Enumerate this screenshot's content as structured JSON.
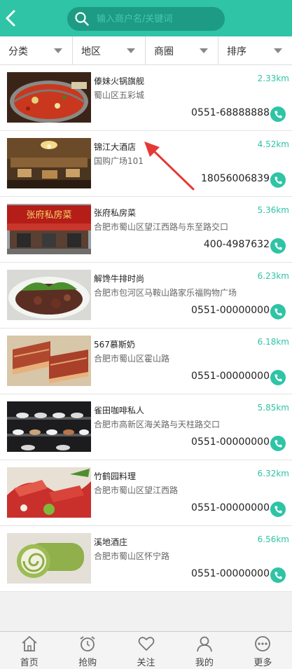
{
  "header": {
    "search_placeholder": "输入商户名/关键词"
  },
  "filters": [
    {
      "label": "分类"
    },
    {
      "label": "地区"
    },
    {
      "label": "商圈"
    },
    {
      "label": "排序"
    }
  ],
  "shops": [
    {
      "name": "傣妹火锅旗舰",
      "address": "蜀山区五彩城",
      "distance": "2.33km",
      "phone": "0551-68888888",
      "image": "hotpot"
    },
    {
      "name": "锦江大酒店",
      "address": "国购广场101",
      "distance": "4.52km",
      "phone": "18056006839",
      "image": "hotel-lobby"
    },
    {
      "name": "张府私房菜",
      "address": "合肥市蜀山区望江西路与东至路交口",
      "distance": "5.36km",
      "phone": "400-4987632",
      "image": "restaurant-front",
      "sign_text": "张府私房菜"
    },
    {
      "name": "解馋牛排时尚",
      "address": "合肥市包河区马鞍山路家乐福购物广场",
      "distance": "6.23km",
      "phone": "0551-00000000",
      "image": "steak"
    },
    {
      "name": "567慕斯奶",
      "address": "合肥市蜀山区霍山路",
      "distance": "6.18km",
      "phone": "0551-00000000",
      "image": "cake"
    },
    {
      "name": "雀田咖啡私人",
      "address": "合肥市高新区海关路与天柱路交口",
      "distance": "5.85km",
      "phone": "0551-00000000",
      "image": "desserts"
    },
    {
      "name": "竹鹤园料理",
      "address": "合肥市蜀山区望江西路",
      "distance": "6.32km",
      "phone": "0551-00000000",
      "image": "sashimi"
    },
    {
      "name": "溪地酒庄",
      "address": "合肥市蜀山区怀宁路",
      "distance": "6.56km",
      "phone": "0551-00000000",
      "image": "roll-cake"
    }
  ],
  "tabbar": [
    {
      "label": "首页",
      "icon": "home-icon"
    },
    {
      "label": "抢购",
      "icon": "alarm-clock-icon"
    },
    {
      "label": "关注",
      "icon": "heart-icon"
    },
    {
      "label": "我的",
      "icon": "user-icon"
    },
    {
      "label": "更多",
      "icon": "more-icon"
    }
  ],
  "colors": {
    "accent": "#2ec4a5",
    "search_bg": "#1e9b84",
    "annotation_arrow": "#e53935"
  }
}
